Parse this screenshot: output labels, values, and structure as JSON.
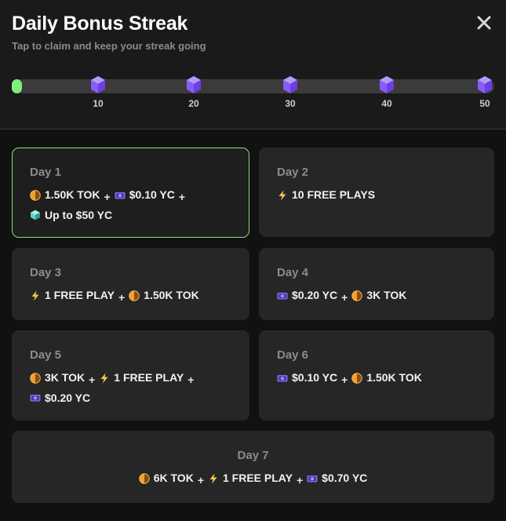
{
  "header": {
    "title": "Daily Bonus Streak",
    "subtitle": "Tap to claim and keep your streak going"
  },
  "progress": {
    "fill_fraction": 0.02,
    "milestones": [
      "10",
      "20",
      "30",
      "40",
      "50"
    ]
  },
  "colors": {
    "accent_green": "#7cf07a",
    "active_border": "#8fdc7e",
    "tok_orange": "#f0a030",
    "yc_purple": "#7b6cf0",
    "bolt_yellow": "#f2c94c",
    "gem_cyan": "#5fd3c4",
    "milestone_purple": "#8a5cf5"
  },
  "icons": {
    "tok": "coin-icon",
    "yc": "cash-icon",
    "play": "lightning-icon",
    "gem": "gem-icon",
    "close": "close-icon",
    "milestone": "cube-icon"
  },
  "days": [
    {
      "label": "Day 1",
      "active": true,
      "lines": [
        [
          {
            "icon": "tok",
            "text": "1.50K TOK"
          },
          {
            "icon": "yc",
            "text": "$0.10 YC"
          }
        ],
        [
          {
            "icon": "gem",
            "text": "Up to $50 YC"
          }
        ]
      ]
    },
    {
      "label": "Day 2",
      "lines": [
        [
          {
            "icon": "play",
            "text": "10 FREE PLAYS"
          }
        ]
      ]
    },
    {
      "label": "Day 3",
      "lines": [
        [
          {
            "icon": "play",
            "text": "1 FREE PLAY"
          },
          {
            "icon": "tok",
            "text": "1.50K TOK"
          }
        ]
      ]
    },
    {
      "label": "Day 4",
      "lines": [
        [
          {
            "icon": "yc",
            "text": "$0.20 YC"
          },
          {
            "icon": "tok",
            "text": "3K TOK"
          }
        ]
      ]
    },
    {
      "label": "Day 5",
      "lines": [
        [
          {
            "icon": "tok",
            "text": "3K TOK"
          },
          {
            "icon": "play",
            "text": "1 FREE PLAY"
          }
        ],
        [
          {
            "icon": "yc",
            "text": "$0.20 YC"
          }
        ]
      ]
    },
    {
      "label": "Day 6",
      "lines": [
        [
          {
            "icon": "yc",
            "text": "$0.10 YC"
          },
          {
            "icon": "tok",
            "text": "1.50K TOK"
          }
        ]
      ]
    },
    {
      "label": "Day 7",
      "lines": [
        [
          {
            "icon": "tok",
            "text": "6K TOK"
          },
          {
            "icon": "play",
            "text": "1 FREE PLAY"
          },
          {
            "icon": "yc",
            "text": "$0.70 YC"
          }
        ]
      ]
    }
  ]
}
